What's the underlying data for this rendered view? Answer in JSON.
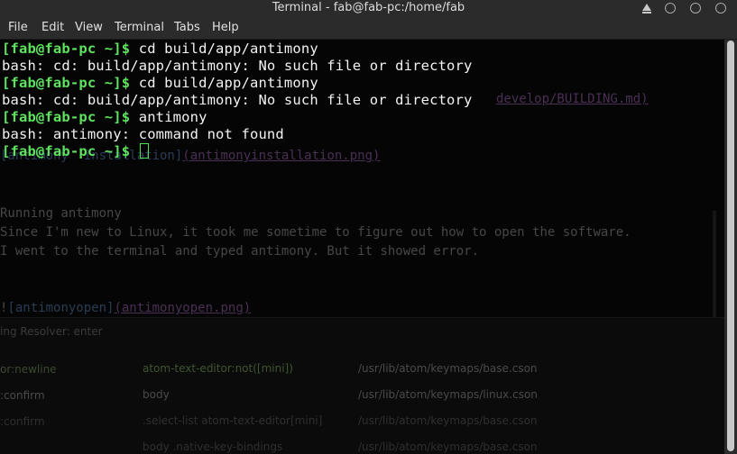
{
  "window": {
    "title": "Terminal - fab@fab-pc:/home/fab"
  },
  "menu": {
    "items": [
      "File",
      "Edit",
      "View",
      "Terminal",
      "Tabs",
      "Help"
    ]
  },
  "terminal": {
    "lines": [
      {
        "prompt": "[fab@fab-pc ~]$",
        "text": " cd build/app/antimony"
      },
      {
        "prompt": "",
        "text": "bash: cd: build/app/antimony: No such file or directory"
      },
      {
        "prompt": "[fab@fab-pc ~]$",
        "text": " cd build/app/antimony"
      },
      {
        "prompt": "",
        "text": "bash: cd: build/app/antimony: No such file or directory"
      },
      {
        "prompt": "[fab@fab-pc ~]$",
        "text": " antimony"
      },
      {
        "prompt": "",
        "text": "bash: antimony: command not found"
      },
      {
        "prompt": "[fab@fab-pc ~]$",
        "text": " "
      }
    ],
    "prompt_color": "#5ee35e",
    "text_color": "#f2f2f2"
  },
  "background_editor": {
    "link_tail": "develop/BUILDING.md)",
    "image_line_a": "[antimony  installation]",
    "image_line_a_link": "(antimonyinstallation.png)",
    "heading": "Running antimony",
    "para1": "Since I'm new to Linux, it took me sometime to figure out how to open the software.",
    "para2": "I went to the terminal and typed antimony. But it showed error.",
    "image_line_b_bang": "!",
    "image_line_b": "[antimonyopen]",
    "image_line_b_link": "(antimonyopen.png)",
    "resolver_header": "ing Resolver: enter",
    "keybindings": [
      {
        "command": "or:newline",
        "selector": "atom-text-editor:not([mini])",
        "source": "/usr/lib/atom/keymaps/base.cson"
      },
      {
        "command": ":confirm",
        "selector": "body",
        "source": "/usr/lib/atom/keymaps/linux.cson"
      },
      {
        "command": ":confirm",
        "selector": ".select-list atom-text-editor[mini]",
        "source": "/usr/lib/atom/keymaps/base.cson"
      },
      {
        "command": "",
        "selector": "body .native-key-bindings",
        "source": "/usr/lib/atom/keymaps/base.cson"
      }
    ]
  }
}
